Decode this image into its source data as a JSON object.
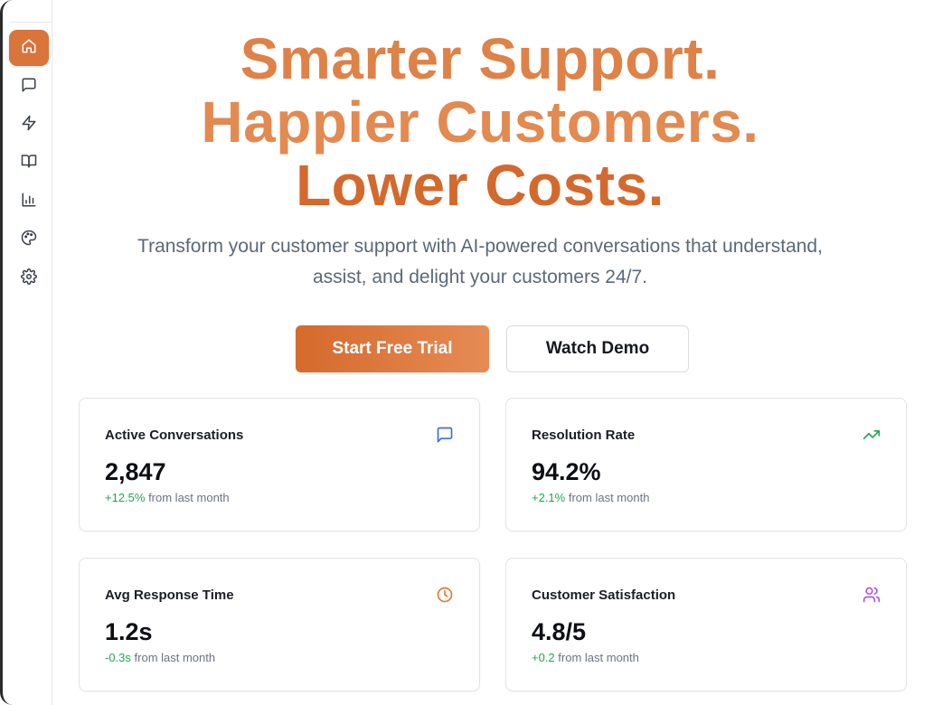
{
  "sidebar": {
    "items": [
      {
        "name": "home",
        "icon": "home-icon",
        "active": true
      },
      {
        "name": "conversations",
        "icon": "message-square-icon",
        "active": false
      },
      {
        "name": "automations",
        "icon": "zap-icon",
        "active": false
      },
      {
        "name": "knowledge-base",
        "icon": "book-open-icon",
        "active": false
      },
      {
        "name": "analytics",
        "icon": "bar-chart-icon",
        "active": false
      },
      {
        "name": "appearance",
        "icon": "palette-icon",
        "active": false
      },
      {
        "name": "settings",
        "icon": "gear-icon",
        "active": false
      }
    ],
    "active_color": "#d9743a"
  },
  "hero": {
    "line1": "Smarter Support.",
    "line2": "Happier Customers.",
    "line3": "Lower Costs.",
    "subtitle": "Transform your customer support with AI-powered conversations that understand, assist, and delight your customers 24/7."
  },
  "actions": {
    "primary_label": "Start Free Trial",
    "secondary_label": "Watch Demo"
  },
  "stats": [
    {
      "label": "Active Conversations",
      "value": "2,847",
      "delta": "+12.5%",
      "delta_suffix": " from last month",
      "icon": "message-square-icon",
      "icon_color": "#3b6fd8"
    },
    {
      "label": "Resolution Rate",
      "value": "94.2%",
      "delta": "+2.1%",
      "delta_suffix": " from last month",
      "icon": "trending-up-icon",
      "icon_color": "#22a552"
    },
    {
      "label": "Avg Response Time",
      "value": "1.2s",
      "delta": "-0.3s",
      "delta_suffix": " from last month",
      "icon": "clock-icon",
      "icon_color": "#e07a33"
    },
    {
      "label": "Customer Satisfaction",
      "value": "4.8/5",
      "delta": "+0.2",
      "delta_suffix": " from last month",
      "icon": "users-icon",
      "icon_color": "#a855f7"
    }
  ],
  "colors": {
    "accent": "#d9743a",
    "positive": "#22a552"
  }
}
